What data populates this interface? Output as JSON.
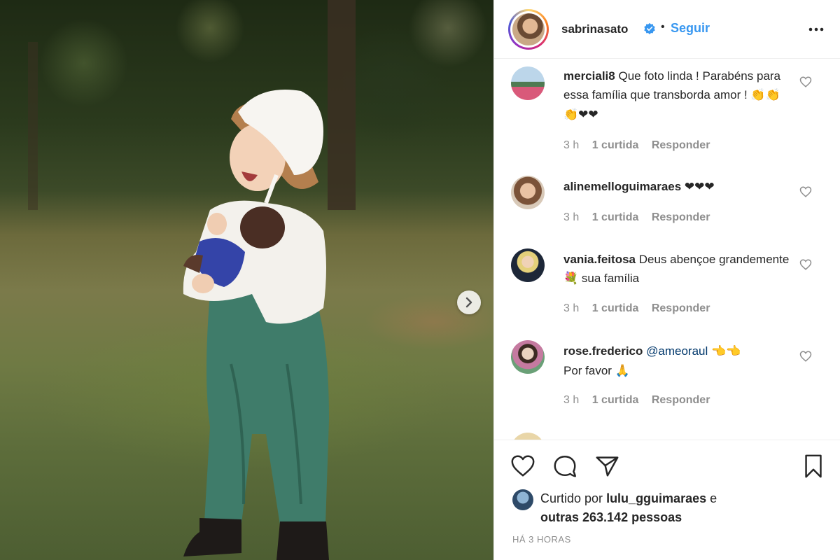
{
  "post": {
    "username": "sabrinasato",
    "dot": "•",
    "follow_label": "Seguir",
    "verified_icon": "verified-badge-icon",
    "more_icon": "more-options-icon"
  },
  "comments": [
    {
      "user": "merciali8",
      "text": "Que foto linda ! Parabéns para essa família que transborda amor !",
      "emojis": "👏👏👏❤❤",
      "time": "3 h",
      "likes": "1 curtida",
      "reply": "Responder"
    },
    {
      "user": "alinemelloguimaraes",
      "text": "",
      "emojis": "❤❤❤",
      "time": "3 h",
      "likes": "1 curtida",
      "reply": "Responder"
    },
    {
      "user": "vania.feitosa",
      "text_before": "Deus abençoe grandemente",
      "emoji_mid": "💐",
      "text_after": "sua família",
      "time": "3 h",
      "likes": "1 curtida",
      "reply": "Responder"
    },
    {
      "user": "rose.frederico",
      "mention": "@ameoraul",
      "emojis": "👈👈",
      "text_line2": "Por favor",
      "emoji_end": "🙏",
      "time": "3 h",
      "likes": "1 curtida",
      "reply": "Responder"
    }
  ],
  "actions": {
    "like_icon": "heart-icon",
    "comment_icon": "comment-icon",
    "share_icon": "share-icon",
    "save_icon": "bookmark-icon"
  },
  "likes": {
    "prefix": "Curtido por",
    "user": "lulu_gguimaraes",
    "conj": "e",
    "others": "outras 263.142 pessoas"
  },
  "time_ago": "HÁ 3 HORAS",
  "colors": {
    "link": "#3897f0",
    "text": "#262626",
    "muted": "#8e8e8e",
    "mention": "#00376b"
  }
}
